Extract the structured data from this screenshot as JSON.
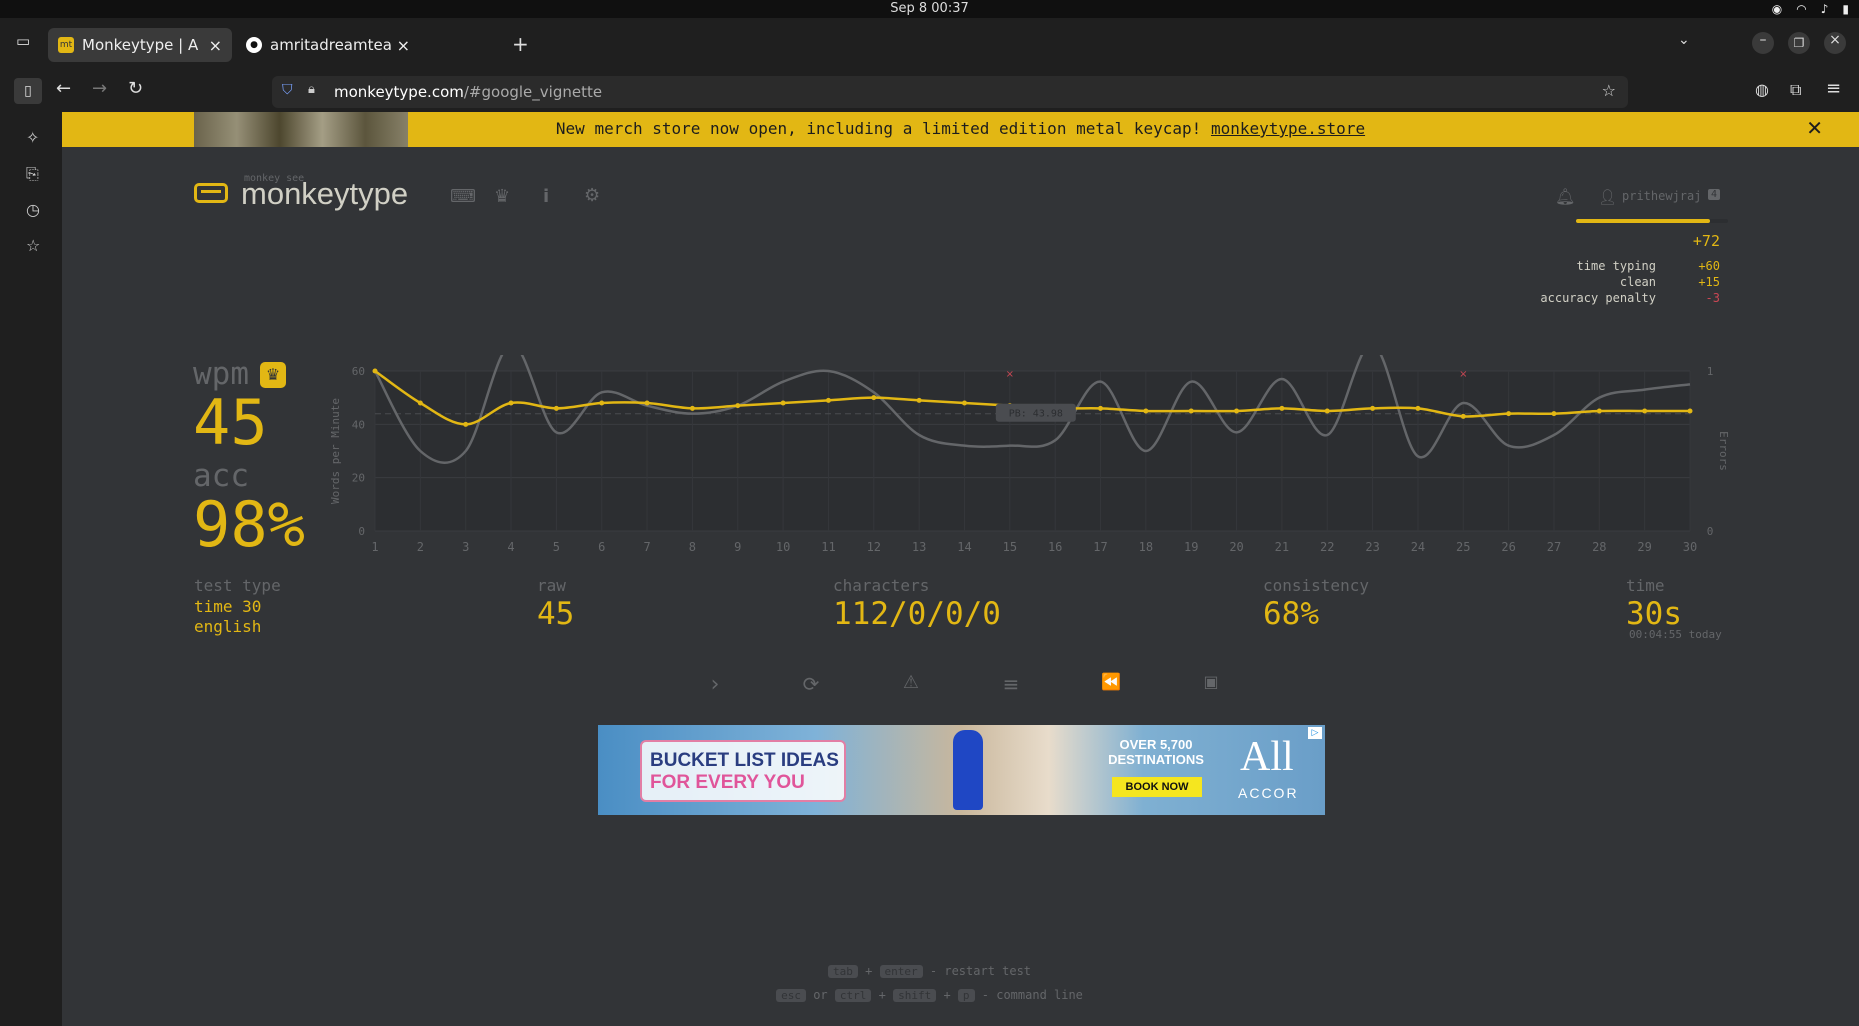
{
  "os": {
    "clock": "Sep 8  00:37"
  },
  "browser": {
    "tabs": [
      {
        "title": "Monkeytype | A minimalis",
        "favicon": "mt"
      },
      {
        "title": "amritadreamteam/genesi",
        "favicon": "github-icon"
      }
    ],
    "url_host": "monkeytype.com",
    "url_path": "/#google_vignette"
  },
  "banner": {
    "text": "New merch store now open, including a limited edition metal keycap!",
    "link": "monkeytype.store"
  },
  "header": {
    "logo_small": "monkey see",
    "logo": "monkeytype",
    "username": "prithewjraj",
    "user_badge": "4",
    "xp_gain": "+72",
    "xp_breakdown": [
      {
        "label": "time typing",
        "value": "+60"
      },
      {
        "label": "clean",
        "value": "+15"
      },
      {
        "label": "accuracy penalty",
        "value": "-3"
      }
    ]
  },
  "result": {
    "wpm_label": "wpm",
    "wpm": "45",
    "acc_label": "acc",
    "acc": "98%",
    "test_type_label": "test type",
    "test_type_1": "time 30",
    "test_type_2": "english",
    "raw_label": "raw",
    "raw": "45",
    "characters_label": "characters",
    "characters": "112/0/0/0",
    "consistency_label": "consistency",
    "consistency": "68%",
    "time_label": "time",
    "time": "30s",
    "time_sub": "00:04:55 today"
  },
  "chart_data": {
    "type": "line",
    "ylabel": "Words per Minute",
    "y2label": "Errors",
    "ylim": [
      0,
      60
    ],
    "y_ticks": [
      "0",
      "20",
      "40",
      "60"
    ],
    "y2_ticks": [
      "0",
      "1"
    ],
    "x": [
      1,
      2,
      3,
      4,
      5,
      6,
      7,
      8,
      9,
      10,
      11,
      12,
      13,
      14,
      15,
      16,
      17,
      18,
      19,
      20,
      21,
      22,
      23,
      24,
      25,
      26,
      27,
      28,
      29,
      30
    ],
    "pb_label": "PB: 43.98",
    "pb_value": 43.98,
    "series": [
      {
        "name": "wpm",
        "color": "#e2b714",
        "values": [
          60,
          48,
          40,
          48,
          46,
          48,
          48,
          46,
          47,
          48,
          49,
          50,
          49,
          48,
          47,
          46,
          46,
          45,
          45,
          45,
          46,
          45,
          46,
          46,
          43,
          44,
          44,
          45,
          45,
          45
        ]
      },
      {
        "name": "raw",
        "color": "#646669",
        "values": [
          60,
          30,
          30,
          70,
          37,
          52,
          47,
          44,
          47,
          56,
          60,
          52,
          36,
          32,
          32,
          34,
          56,
          30,
          56,
          37,
          57,
          36,
          70,
          28,
          48,
          32,
          36,
          50,
          53,
          55
        ]
      }
    ],
    "errors": [
      {
        "x": 15,
        "count": 1
      },
      {
        "x": 25,
        "count": 1
      }
    ]
  },
  "actions": [
    {
      "name": "next-test-icon",
      "glyph": "›"
    },
    {
      "name": "restart-icon",
      "glyph": "⟳"
    },
    {
      "name": "report-icon",
      "glyph": "⚠"
    },
    {
      "name": "words-history-icon",
      "glyph": "≡"
    },
    {
      "name": "replay-icon",
      "glyph": "⏪"
    },
    {
      "name": "screenshot-icon",
      "glyph": "▣"
    }
  ],
  "ad": {
    "headline_1": "BUCKET LIST IDEAS",
    "headline_2": "FOR EVERY YOU",
    "over": "OVER 5,700",
    "destinations": "DESTINATIONS",
    "book": "BOOK NOW",
    "brand_1": "All",
    "brand_2": "ACCOR"
  },
  "footer": {
    "k1": "tab",
    "plus1": "+",
    "k2": "enter",
    "action1": "- restart test",
    "k3": "esc",
    "or": "or",
    "k4": "ctrl",
    "plus2": "+",
    "k5": "shift",
    "plus3": "+",
    "k6": "p",
    "action2": "- command line"
  }
}
